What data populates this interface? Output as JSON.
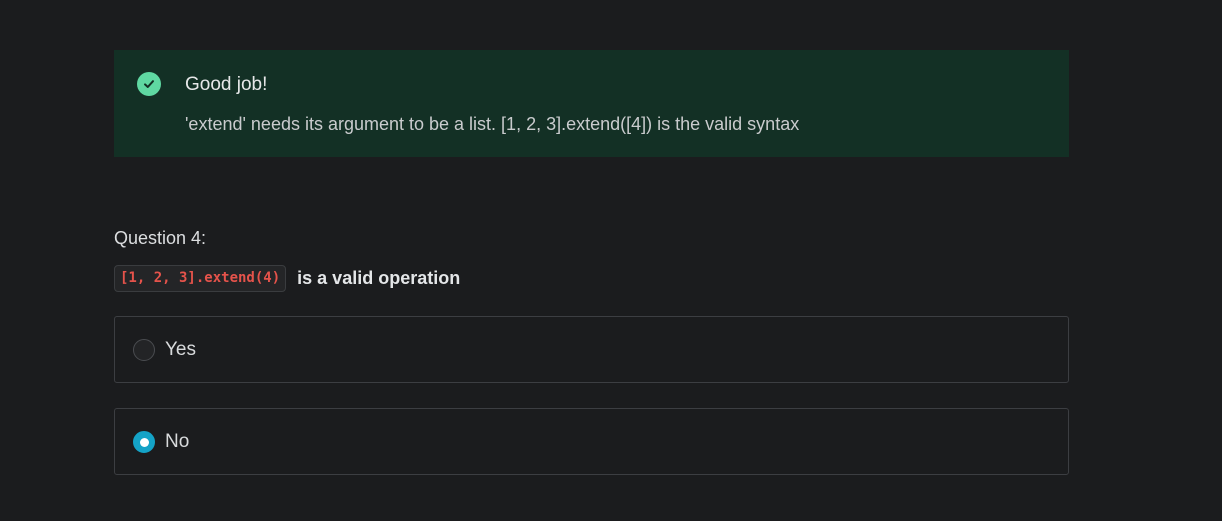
{
  "feedback": {
    "title": "Good job!",
    "message": "'extend' needs its argument to be a list. [1, 2, 3].extend([4]) is the valid syntax",
    "icon": "check-circle-icon",
    "accent_color": "#5fd8a2",
    "background_color": "#133025"
  },
  "question": {
    "label": "Question 4:",
    "code": "[1, 2, 3].extend(4)",
    "text": "is a valid operation",
    "code_color": "#e5534b"
  },
  "options": [
    {
      "label": "Yes",
      "selected": false
    },
    {
      "label": "No",
      "selected": true
    }
  ],
  "colors": {
    "page_background": "#1b1c1e",
    "radio_selected": "#14a3c7"
  }
}
